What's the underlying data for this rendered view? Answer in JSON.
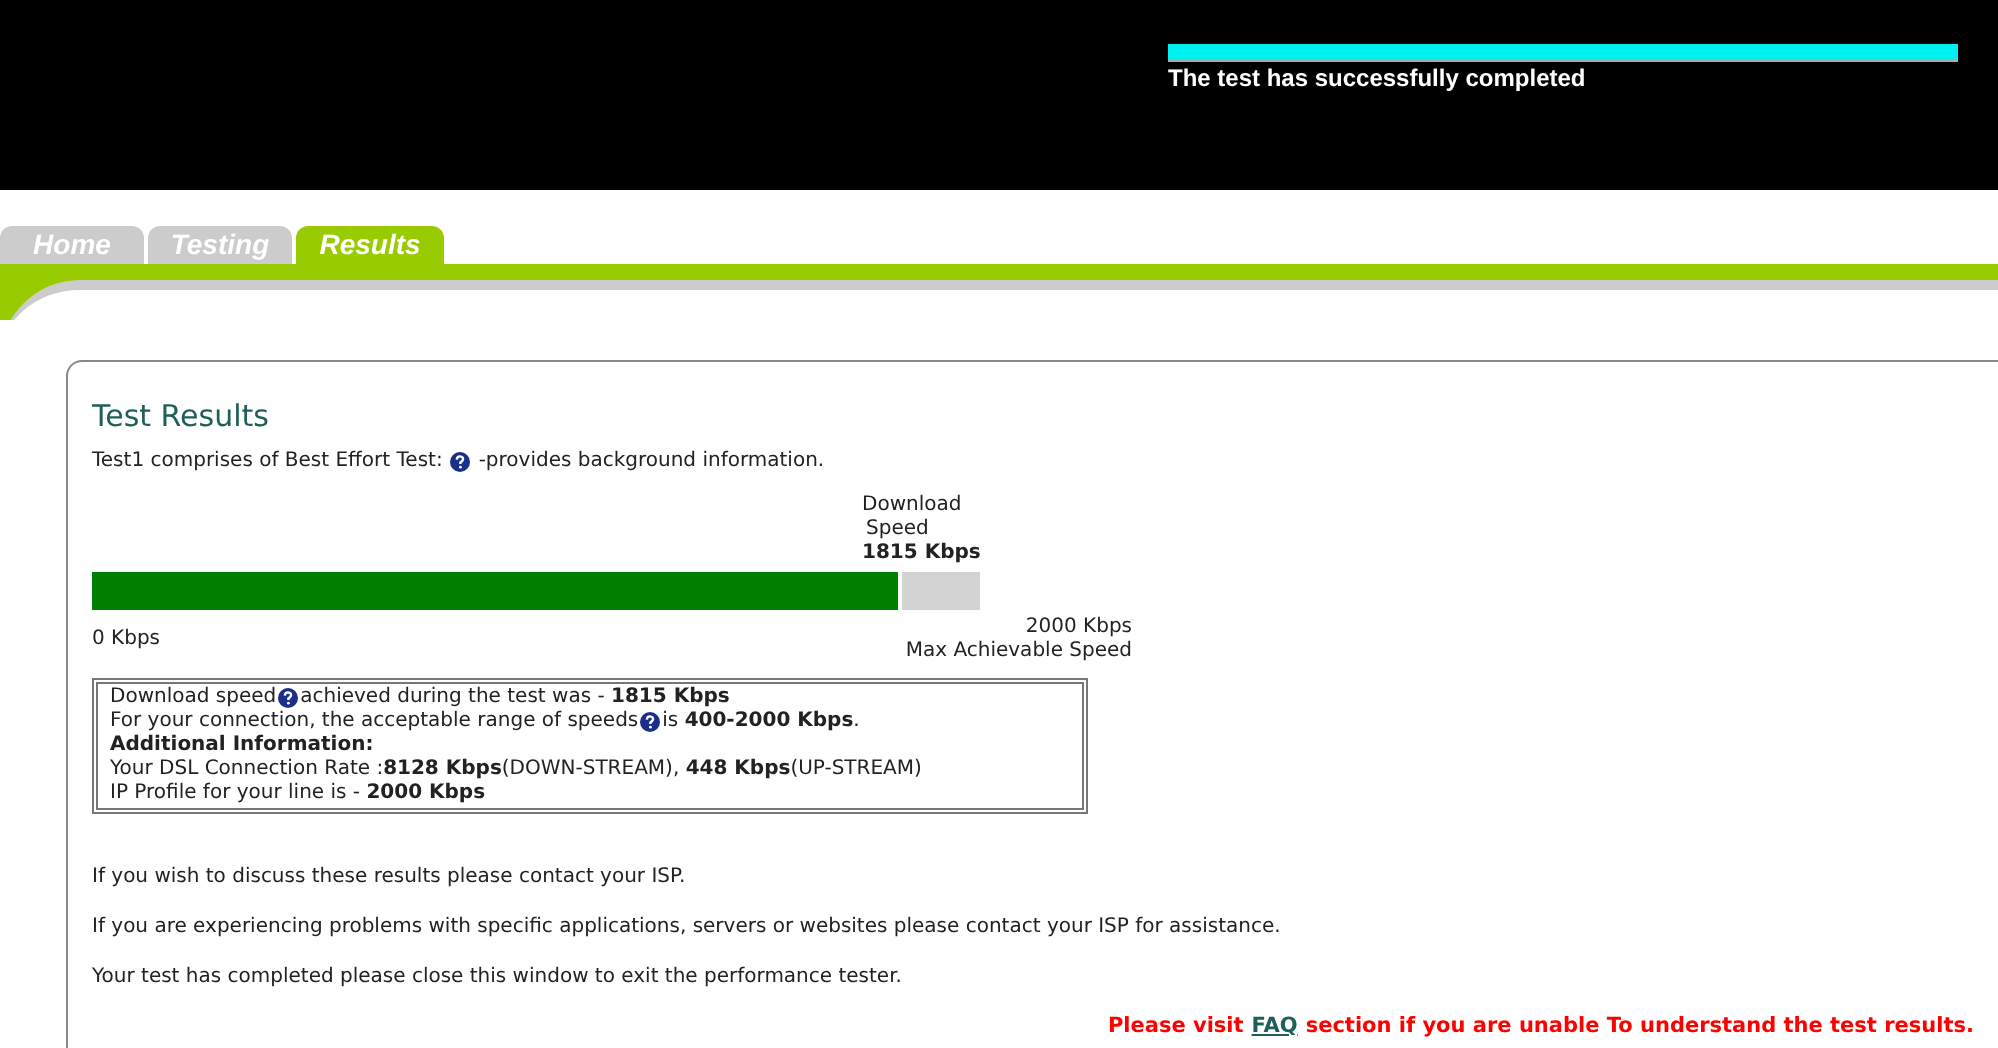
{
  "header": {
    "status": "The test has successfully completed"
  },
  "tabs": [
    {
      "label": "Home",
      "selected": false
    },
    {
      "label": "Testing",
      "selected": false
    },
    {
      "label": "Results",
      "selected": true
    }
  ],
  "results": {
    "title": "Test Results",
    "intro_before": "Test1 comprises of Best Effort Test:",
    "intro_after": "-provides background information.",
    "meter": {
      "label_line1": "Download",
      "label_line2": "Speed",
      "reading": "1815 Kbps",
      "level": 0.9075,
      "min": "0 Kbps",
      "max": "2000 Kbps",
      "max_caption": "Max Achievable Speed"
    },
    "info_lines": [
      {
        "before": "Download speed",
        "help": true,
        "after": "achieved during the test was - **1815 Kbps**"
      },
      {
        "before": "For your connection, the acceptable range of speeds",
        "help": true,
        "after": " is **400-2000 Kbps**."
      },
      {
        "before": "**Additional Information:**",
        "help": false
      },
      {
        "before": "Your DSL Connection Rate :**8128 Kbps**(DOWN-STREAM), **448 Kbps**(UP-STREAM)",
        "help": false
      },
      {
        "before": "IP Profile for your line is - **2000 Kbps**",
        "help": false
      }
    ],
    "notes": [
      "If you wish to discuss these results please contact your ISP.",
      "If you are experiencing problems with specific applications, servers or websites please contact your ISP for assistance.",
      "Your test has completed please close this window to exit the performance tester."
    ],
    "faq": {
      "before": "Please visit",
      "link": "FAQ",
      "after": "section if you are unable To understand the test results."
    }
  }
}
